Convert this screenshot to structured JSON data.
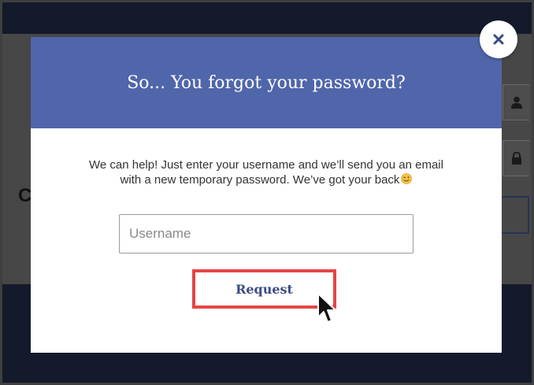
{
  "modal": {
    "title": "So... You forgot your password?",
    "description": "We can help! Just enter your username and we’ll send you an email with a new temporary password. We’ve got your back",
    "username_placeholder": "Username",
    "username_value": "",
    "request_label": "Request"
  },
  "background_page": {
    "partial_heading": "C"
  },
  "icons": {
    "close": "close-icon",
    "wink": "winking-face-icon",
    "user": "user-icon",
    "lock": "lock-icon",
    "cursor": "mouse-pointer-icon"
  },
  "colors": {
    "header": "#5066ab",
    "button_text": "#3b4b86",
    "highlight": "#e64545",
    "overlay_dark": "#141a2c"
  }
}
